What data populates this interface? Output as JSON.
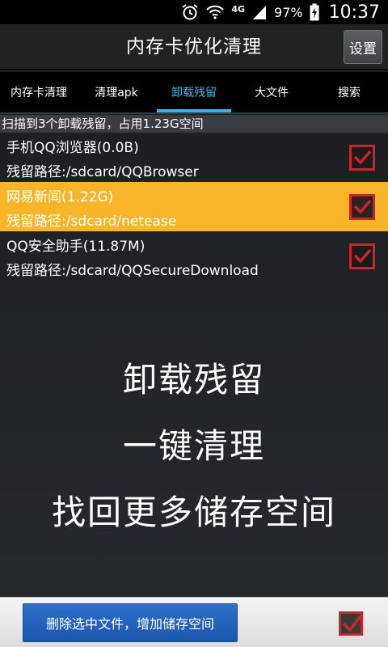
{
  "status_bar": {
    "network": "4G",
    "battery": "97%",
    "time": "10:37"
  },
  "header": {
    "title": "内存卡优化清理",
    "settings_label": "设置"
  },
  "tabs": [
    {
      "label": "内存卡清理",
      "active": false
    },
    {
      "label": "清理apk",
      "active": false
    },
    {
      "label": "卸载残留",
      "active": true
    },
    {
      "label": "大文件",
      "active": false
    },
    {
      "label": "搜索",
      "active": false
    }
  ],
  "summary": "扫描到3个卸载残留，占用1.23G空间",
  "items": [
    {
      "name": "手机QQ浏览器(0.0B)",
      "path": "残留路径:/sdcard/QQBrowser",
      "checked": true,
      "selected": false
    },
    {
      "name": "网易新闻(1.22G)",
      "path": "残留路径:/sdcard/netease",
      "checked": true,
      "selected": true
    },
    {
      "name": "QQ安全助手(11.87M)",
      "path": "残留路径:/sdcard/QQSecureDownload",
      "checked": true,
      "selected": false
    }
  ],
  "promo": {
    "line1": "卸载残留",
    "line2": "一键清理",
    "line3": "找回更多储存空间"
  },
  "footer": {
    "delete_label": "删除选中文件，增加储存空间",
    "select_all_checked": true
  },
  "colors": {
    "accent": "#33b5e5",
    "selected_row": "#f9b52a",
    "check": "#c8262b",
    "button": "#1c56ad"
  }
}
